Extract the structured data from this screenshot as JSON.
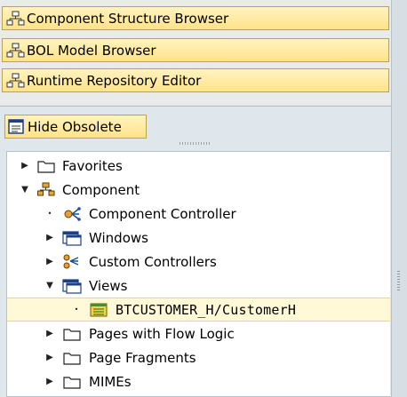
{
  "nav": {
    "buttons": [
      {
        "label": "Component Structure Browser",
        "icon": "structure-icon"
      },
      {
        "label": "BOL Model Browser",
        "icon": "structure-icon"
      },
      {
        "label": "Runtime Repository Editor",
        "icon": "structure-icon"
      }
    ]
  },
  "toolbar": {
    "hide_obsolete_label": "Hide Obsolete"
  },
  "tree": {
    "rows": [
      {
        "label": "Favorites",
        "toggle": "collapsed",
        "icon": "folder-icon"
      },
      {
        "label": "Component",
        "toggle": "expanded",
        "icon": "component-icon"
      },
      {
        "label": "Component Controller",
        "toggle": "leaf",
        "icon": "controller-icon"
      },
      {
        "label": "Windows",
        "toggle": "collapsed",
        "icon": "window-icon"
      },
      {
        "label": "Custom Controllers",
        "toggle": "collapsed",
        "icon": "custom-controller-icon"
      },
      {
        "label": "Views",
        "toggle": "expanded",
        "icon": "window-icon"
      },
      {
        "label": "BTCUSTOMER_H/CustomerH",
        "toggle": "leaf",
        "icon": "view-icon",
        "selected": true
      },
      {
        "label": "Pages with Flow Logic",
        "toggle": "collapsed",
        "icon": "folder-icon"
      },
      {
        "label": "Page Fragments",
        "toggle": "collapsed",
        "icon": "folder-icon"
      },
      {
        "label": "MIMEs",
        "toggle": "collapsed",
        "icon": "folder-icon"
      }
    ]
  },
  "colors": {
    "button_top": "#fff3bf",
    "button_bottom": "#ffe389",
    "button_border": "#b9a350",
    "panel_bg": "#dfe6ec",
    "tree_bg": "#ffffff",
    "selection_bg": "#fff9d8"
  }
}
